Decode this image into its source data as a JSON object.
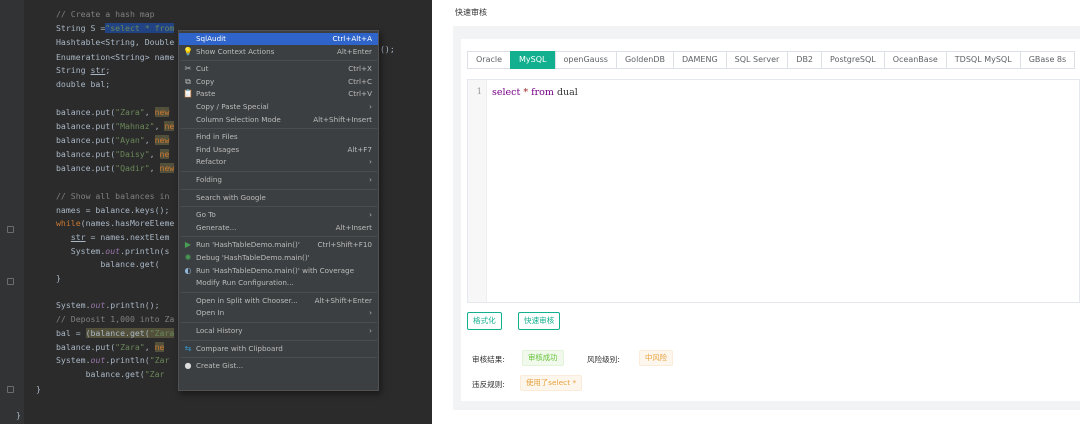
{
  "ide": {
    "code_lines": [
      [
        {
          "t": "// Create a hash map",
          "c": "cm"
        }
      ],
      [
        {
          "t": "String S =",
          "c": ""
        },
        {
          "t": "\"select * from",
          "c": "str sel"
        }
      ],
      [
        {
          "t": "Hashtable<String, Double",
          "c": ""
        }
      ],
      [
        {
          "t": "Enumeration<String> name",
          "c": ""
        }
      ],
      [
        {
          "t": "String ",
          "c": ""
        },
        {
          "t": "str",
          "c": "u"
        },
        {
          "t": ";",
          "c": ""
        }
      ],
      [
        {
          "t": "double bal;",
          "c": ""
        }
      ],
      [],
      [
        {
          "t": "balance.put(",
          "c": ""
        },
        {
          "t": "\"Zara\"",
          "c": "str"
        },
        {
          "t": ", ",
          "c": ""
        },
        {
          "t": "new",
          "c": "kw hl"
        }
      ],
      [
        {
          "t": "balance.put(",
          "c": ""
        },
        {
          "t": "\"Mahnaz\"",
          "c": "str"
        },
        {
          "t": ", ",
          "c": ""
        },
        {
          "t": "ne",
          "c": "kw hl"
        }
      ],
      [
        {
          "t": "balance.put(",
          "c": ""
        },
        {
          "t": "\"Ayan\"",
          "c": "str"
        },
        {
          "t": ", ",
          "c": ""
        },
        {
          "t": "new",
          "c": "kw hl"
        }
      ],
      [
        {
          "t": "balance.put(",
          "c": ""
        },
        {
          "t": "\"Daisy\"",
          "c": "str"
        },
        {
          "t": ", ",
          "c": ""
        },
        {
          "t": "ne",
          "c": "kw hl"
        }
      ],
      [
        {
          "t": "balance.put(",
          "c": ""
        },
        {
          "t": "\"Qadir\"",
          "c": "str"
        },
        {
          "t": ", ",
          "c": ""
        },
        {
          "t": "new",
          "c": "kw hl"
        }
      ],
      [],
      [
        {
          "t": "// Show all balances in",
          "c": "cm"
        }
      ],
      [
        {
          "t": "names = balance.keys();",
          "c": ""
        }
      ],
      [
        {
          "t": "while",
          "c": "kw"
        },
        {
          "t": "(names.hasMoreEleme",
          "c": ""
        }
      ],
      [
        {
          "t": "   ",
          "c": ""
        },
        {
          "t": "str",
          "c": "u"
        },
        {
          "t": " = names.nextElem",
          "c": ""
        }
      ],
      [
        {
          "t": "   System.",
          "c": ""
        },
        {
          "t": "out",
          "c": "fld"
        },
        {
          "t": ".println(s",
          "c": ""
        }
      ],
      [
        {
          "t": "         balance.get(",
          "c": ""
        }
      ],
      [
        {
          "t": "}",
          "c": ""
        }
      ],
      [],
      [
        {
          "t": "System.",
          "c": ""
        },
        {
          "t": "out",
          "c": "fld"
        },
        {
          "t": ".println();",
          "c": ""
        }
      ],
      [
        {
          "t": "// Deposit 1,000 into Za",
          "c": "cm"
        }
      ],
      [
        {
          "t": "bal = ",
          "c": ""
        },
        {
          "t": "(balance.get(",
          "c": "hl"
        },
        {
          "t": "\"Zara",
          "c": "str hl"
        }
      ],
      [
        {
          "t": "balance.put(",
          "c": ""
        },
        {
          "t": "\"Zara\"",
          "c": "str"
        },
        {
          "t": ", ",
          "c": ""
        },
        {
          "t": "ne",
          "c": "kw hl"
        }
      ],
      [
        {
          "t": "System.",
          "c": ""
        },
        {
          "t": "out",
          "c": "fld"
        },
        {
          "t": ".println(",
          "c": ""
        },
        {
          "t": "\"Zar",
          "c": "str"
        }
      ],
      [
        {
          "t": "      balance.get(",
          "c": ""
        },
        {
          "t": "\"Zar",
          "c": "str"
        }
      ]
    ],
    "overflow_text": "();",
    "brace_inner": "}",
    "brace_outer": "}"
  },
  "context_menu": {
    "items": [
      {
        "label": "SqlAudit",
        "shortcut": "Ctrl+Alt+A",
        "icon": "",
        "highlighted": true
      },
      {
        "label": "Show Context Actions",
        "shortcut": "Alt+Enter",
        "icon": "lightbulb-icon",
        "glyph": "💡"
      },
      {
        "sep": true
      },
      {
        "label": "Cut",
        "shortcut": "Ctrl+X",
        "icon": "scissors-icon",
        "glyph": "✂"
      },
      {
        "label": "Copy",
        "shortcut": "Ctrl+C",
        "icon": "copy-icon",
        "glyph": "⧉"
      },
      {
        "label": "Paste",
        "shortcut": "Ctrl+V",
        "icon": "clipboard-icon",
        "glyph": "📋"
      },
      {
        "label": "Copy / Paste Special",
        "shortcut": "›",
        "icon": ""
      },
      {
        "label": "Column Selection Mode",
        "shortcut": "Alt+Shift+Insert",
        "icon": ""
      },
      {
        "sep": true
      },
      {
        "label": "Find in Files",
        "shortcut": "",
        "icon": ""
      },
      {
        "label": "Find Usages",
        "shortcut": "Alt+F7",
        "icon": ""
      },
      {
        "label": "Refactor",
        "shortcut": "›",
        "icon": ""
      },
      {
        "sep": true
      },
      {
        "label": "Folding",
        "shortcut": "›",
        "icon": ""
      },
      {
        "sep": true
      },
      {
        "label": "Search with Google",
        "shortcut": "",
        "icon": ""
      },
      {
        "sep": true
      },
      {
        "label": "Go To",
        "shortcut": "›",
        "icon": ""
      },
      {
        "label": "Generate...",
        "shortcut": "Alt+Insert",
        "icon": ""
      },
      {
        "sep": true
      },
      {
        "label": "Run 'HashTableDemo.main()'",
        "shortcut": "Ctrl+Shift+F10",
        "icon": "run-icon",
        "glyph": "▶",
        "gcolor": "#499c54"
      },
      {
        "label": "Debug 'HashTableDemo.main()'",
        "shortcut": "",
        "icon": "debug-icon",
        "glyph": "✺",
        "gcolor": "#499c54"
      },
      {
        "label": "Run 'HashTableDemo.main()' with Coverage",
        "shortcut": "",
        "icon": "coverage-icon",
        "glyph": "◐",
        "gcolor": "#8fb4d6"
      },
      {
        "label": "Modify Run Configuration...",
        "shortcut": "",
        "icon": ""
      },
      {
        "sep": true
      },
      {
        "label": "Open in Split with Chooser...",
        "shortcut": "Alt+Shift+Enter",
        "icon": ""
      },
      {
        "label": "Open In",
        "shortcut": "›",
        "icon": ""
      },
      {
        "sep": true
      },
      {
        "label": "Local History",
        "shortcut": "›",
        "icon": ""
      },
      {
        "sep": true
      },
      {
        "label": "Compare with Clipboard",
        "shortcut": "",
        "icon": "compare-icon",
        "glyph": "⇆",
        "gcolor": "#3592c4"
      },
      {
        "sep": true
      },
      {
        "label": "Create Gist...",
        "shortcut": "",
        "icon": "github-icon",
        "glyph": "●",
        "gcolor": "#dddddd"
      }
    ]
  },
  "right": {
    "title": "快速审核",
    "tabs": [
      "Oracle",
      "MySQL",
      "openGauss",
      "GoldenDB",
      "DAMENG",
      "SQL Server",
      "DB2",
      "PostgreSQL",
      "OceanBase",
      "TDSQL MySQL",
      "GBase 8s"
    ],
    "active_tab": "MySQL",
    "editor": {
      "line_number": "1",
      "sql_select": "select",
      "sql_star": "*",
      "sql_from": "from",
      "sql_table": "dual"
    },
    "format_button": "格式化",
    "audit_button": "快速审核",
    "result_label": "审核结果:",
    "result_value": "审核成功",
    "risk_label": "风险级别:",
    "risk_value": "中风险",
    "violation_label": "违反规则:",
    "violation_value": "使用了select *"
  },
  "colors": {
    "accent": "#13b08f",
    "ide_bg": "#2b2b2b",
    "menu_bg": "#3c3f41",
    "menu_highlight": "#2f65ca"
  }
}
